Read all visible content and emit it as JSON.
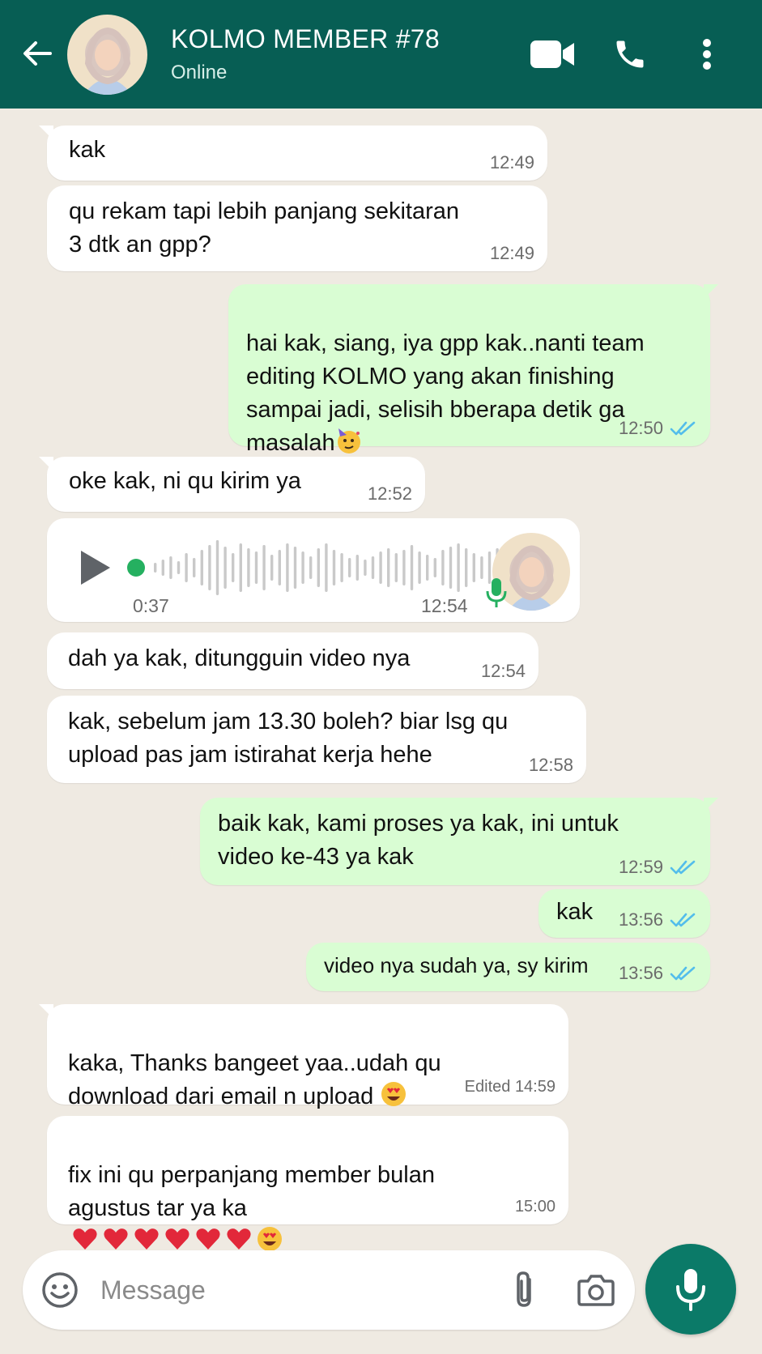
{
  "header": {
    "title": "KOLMO MEMBER #78",
    "status": "Online",
    "icons": [
      "back-arrow-icon",
      "video-call-icon",
      "phone-icon",
      "more-vert-icon"
    ],
    "color": "#075e54"
  },
  "messages": [
    {
      "dir": "in",
      "text": "kak",
      "time": "12:49"
    },
    {
      "dir": "in",
      "text": "qu rekam tapi lebih panjang sekitaran\n3 dtk an gpp?",
      "time": "12:49"
    },
    {
      "dir": "out",
      "text": "hai kak, siang, iya gpp kak..nanti team\nediting KOLMO yang akan finishing\nsampai jadi, selisih bberapa detik ga\nmasalah",
      "emoji": "partying-face-emoji",
      "time": "12:50",
      "status": "read"
    },
    {
      "dir": "in",
      "text": "oke kak, ni qu kirim ya",
      "time": "12:52"
    },
    {
      "dir": "in",
      "type": "voice",
      "duration": "0:37",
      "time": "12:54"
    },
    {
      "dir": "in",
      "text": "dah ya kak, ditungguin video nya",
      "time": "12:54"
    },
    {
      "dir": "in",
      "text": "kak, sebelum jam 13.30 boleh? biar lsg qu\nupload pas jam istirahat kerja hehe",
      "time": "12:58"
    },
    {
      "dir": "out",
      "text": "baik kak, kami proses ya kak, ini untuk\nvideo ke-43 ya kak",
      "time": "12:59",
      "status": "read"
    },
    {
      "dir": "out",
      "text": "kak",
      "time": "13:56",
      "status": "read"
    },
    {
      "dir": "out",
      "text": "video nya sudah ya, sy kirim",
      "time": "13:56",
      "status": "read"
    },
    {
      "dir": "in",
      "text": "kaka, Thanks bangeet yaa..udah qu\ndownload dari email n upload",
      "emoji": "heart-eyes-emoji",
      "time": "Edited 14:59"
    },
    {
      "dir": "in",
      "text": "fix ini qu perpanjang member bulan\nagustus tar ya ka",
      "emoji": "six-red-hearts-and-heart-eyes-emoji",
      "time": "15:00"
    }
  ],
  "composer": {
    "placeholder": "Message",
    "icons": [
      "emoji-icon",
      "attach-icon",
      "camera-icon",
      "mic-icon"
    ],
    "mic_color": "#0b7a68"
  },
  "colors": {
    "outgoing_bubble": "#d9fdd3",
    "incoming_bubble": "#ffffff",
    "read_ticks": "#53bdeb"
  }
}
